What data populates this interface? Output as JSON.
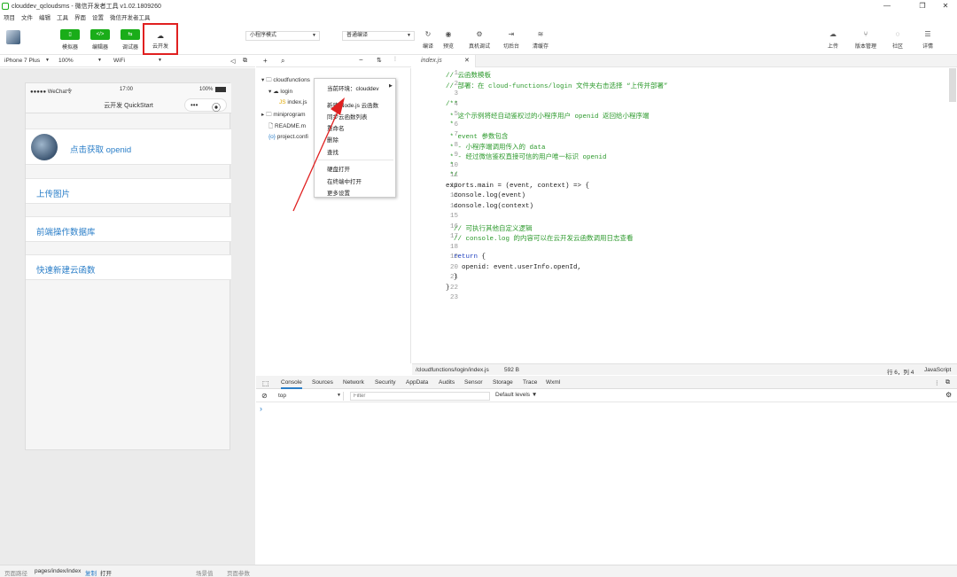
{
  "window": {
    "title": "clouddev_qcloudsms - 微信开发者工具 v1.02.1809260"
  },
  "menu": [
    "项目",
    "文件",
    "编辑",
    "工具",
    "界面",
    "设置",
    "微信开发者工具"
  ],
  "toolbar": {
    "simulator": "模拟器",
    "editor": "编辑器",
    "debugger": "调试器",
    "cloud": "云开发",
    "mode_select": "小程序模式",
    "compile_select": "普通编译",
    "compile": "编译",
    "preview": "预览",
    "real_debug": "真机调试",
    "backend": "切后台",
    "clear_cache": "清缓存",
    "upload": "上传",
    "version": "版本管理",
    "community": "社区",
    "details": "详情"
  },
  "device_bar": {
    "device": "iPhone 7 Plus",
    "zoom": "100%",
    "network": "WiFi"
  },
  "phone": {
    "carrier": "●●●●● WeChat令",
    "time": "17:00",
    "battery": "100%",
    "nav_title": "云开发 QuickStart",
    "items": [
      "点击获取 openid",
      "上传图片",
      "前端操作数据库",
      "快速新建云函数"
    ]
  },
  "file_tree": {
    "items": [
      "cloudfunctions",
      "login",
      "index.js",
      "miniprogram",
      "README.m",
      "project.confi"
    ]
  },
  "context_menu": {
    "env": "当前环境：clouddev",
    "items": [
      "新建 Node.js 云函数",
      "同步云函数列表",
      "重命名",
      "删除",
      "查找",
      "硬盘打开",
      "在终端中打开",
      "更多设置"
    ]
  },
  "editor": {
    "tab": "index.js",
    "lines": [
      [
        {
          "t": "// 云函数模板",
          "c": "cm"
        }
      ],
      [
        {
          "t": "// 部署：在 cloud-functions/login 文件夹右击选择 “上传并部署”",
          "c": "cm"
        }
      ],
      [
        {
          "t": "",
          "c": ""
        }
      ],
      [
        {
          "t": "/**",
          "c": "cm"
        }
      ],
      [
        {
          "t": " * 这个示例将经自动鉴权过的小程序用户 openid 返回给小程序端",
          "c": "cm"
        }
      ],
      [
        {
          "t": " *",
          "c": "cm"
        }
      ],
      [
        {
          "t": " * event 参数包含",
          "c": "cm"
        }
      ],
      [
        {
          "t": " * - 小程序端调用传入的 data",
          "c": "cm"
        }
      ],
      [
        {
          "t": " * - 经过微信鉴权直接可信的用户唯一标识 openid",
          "c": "cm"
        }
      ],
      [
        {
          "t": " *",
          "c": "cm"
        }
      ],
      [
        {
          "t": " */",
          "c": "cm"
        }
      ],
      [
        {
          "t": "exports.main = (event, context) => {",
          "c": ""
        }
      ],
      [
        {
          "t": "  console.log(event)",
          "c": ""
        }
      ],
      [
        {
          "t": "  console.log(context)",
          "c": ""
        }
      ],
      [
        {
          "t": "",
          "c": ""
        }
      ],
      [
        {
          "t": "  // 可执行其他自定义逻辑",
          "c": "cm"
        }
      ],
      [
        {
          "t": "  // console.log 的内容可以在云开发云函数调用日志查看",
          "c": "cm"
        }
      ],
      [
        {
          "t": "",
          "c": ""
        }
      ],
      [
        {
          "t": "  ",
          "c": ""
        },
        {
          "t": "return",
          "c": "kw"
        },
        {
          "t": " {",
          "c": ""
        }
      ],
      [
        {
          "t": "    openid: event.userInfo.openId,",
          "c": ""
        }
      ],
      [
        {
          "t": "  }",
          "c": ""
        }
      ],
      [
        {
          "t": "}",
          "c": ""
        }
      ],
      [
        {
          "t": "",
          "c": ""
        }
      ]
    ],
    "status_path": "/cloudfunctions/login/index.js",
    "status_size": "592 B",
    "status_pos": "行 6，列 4",
    "status_lang": "JavaScript"
  },
  "console": {
    "tabs": [
      "Console",
      "Sources",
      "Network",
      "Security",
      "AppData",
      "Audits",
      "Sensor",
      "Storage",
      "Trace",
      "Wxml"
    ],
    "context": "top",
    "filter_placeholder": "Filter",
    "levels": "Default levels ▼",
    "prompt": "›"
  },
  "bottom_bar": {
    "path_label": "页面路径",
    "path": "pages/index/index",
    "copy": "复制",
    "open": "打开",
    "scene": "场景值",
    "params": "页面参数"
  }
}
